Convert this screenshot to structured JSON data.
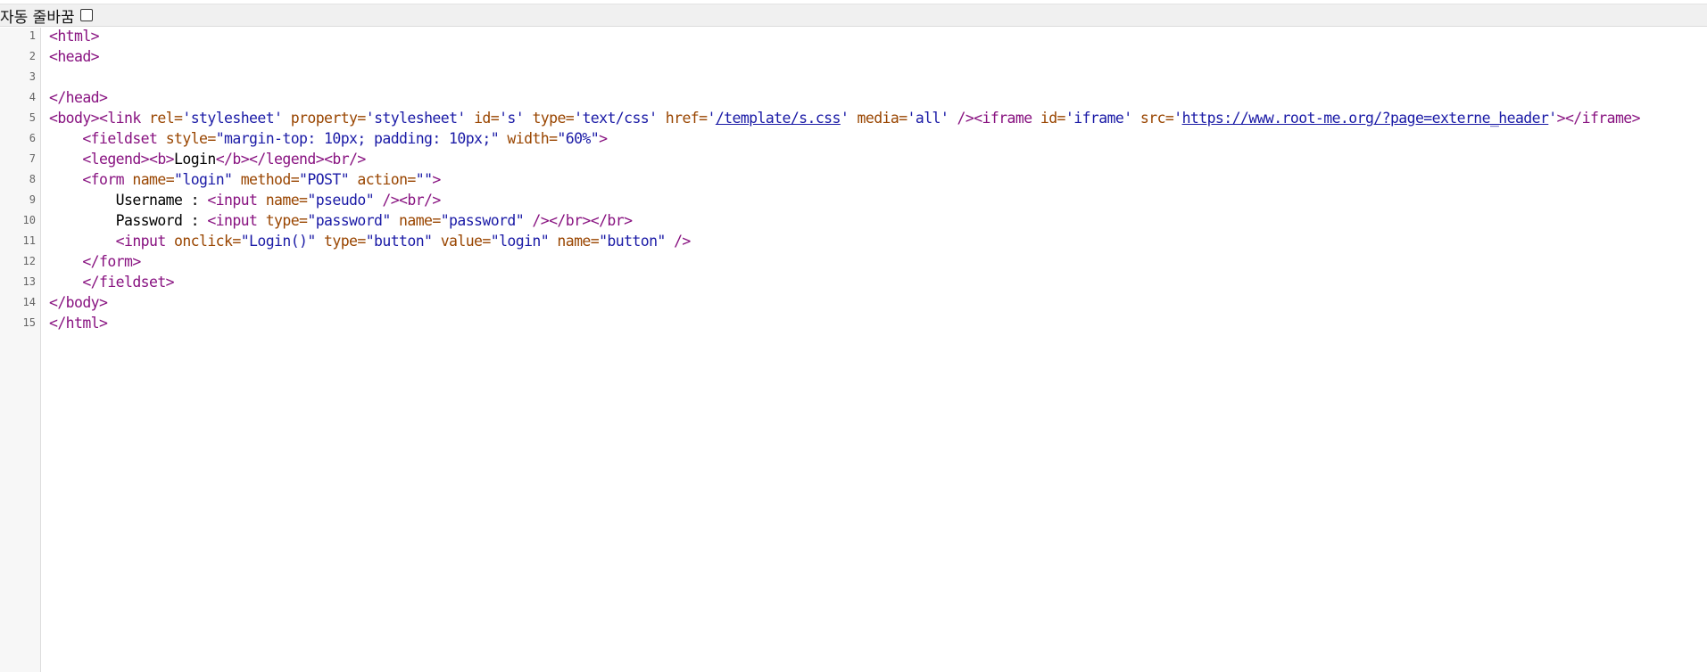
{
  "toolbar": {
    "wrap_label": "자동 줄바꿈",
    "wrap_checked": false
  },
  "lines": [
    {
      "num": "1",
      "tokens": [
        {
          "t": "tag",
          "v": "<html>"
        }
      ]
    },
    {
      "num": "2",
      "tokens": [
        {
          "t": "tag",
          "v": "<head>"
        }
      ]
    },
    {
      "num": "3",
      "tokens": []
    },
    {
      "num": "4",
      "tokens": [
        {
          "t": "tag",
          "v": "</head>"
        }
      ]
    },
    {
      "num": "5",
      "tokens": [
        {
          "t": "tag",
          "v": "<body>"
        },
        {
          "t": "tag",
          "v": "<link "
        },
        {
          "t": "attr",
          "v": "rel="
        },
        {
          "t": "val",
          "v": "'stylesheet'"
        },
        {
          "t": "attr",
          "v": " property="
        },
        {
          "t": "val",
          "v": "'stylesheet'"
        },
        {
          "t": "attr",
          "v": " id="
        },
        {
          "t": "val",
          "v": "'s'"
        },
        {
          "t": "attr",
          "v": " type="
        },
        {
          "t": "val",
          "v": "'text/css'"
        },
        {
          "t": "attr",
          "v": " href="
        },
        {
          "t": "val",
          "v": "'"
        },
        {
          "t": "link",
          "v": "/template/s.css"
        },
        {
          "t": "val",
          "v": "'"
        },
        {
          "t": "attr",
          "v": " media="
        },
        {
          "t": "val",
          "v": "'all'"
        },
        {
          "t": "tag",
          "v": " />"
        },
        {
          "t": "tag",
          "v": "<iframe "
        },
        {
          "t": "attr",
          "v": "id="
        },
        {
          "t": "val",
          "v": "'iframe'"
        },
        {
          "t": "attr",
          "v": " src="
        },
        {
          "t": "val",
          "v": "'"
        },
        {
          "t": "link",
          "v": "https://www.root-me.org/?page=externe_header"
        },
        {
          "t": "val",
          "v": "'"
        },
        {
          "t": "tag",
          "v": "></iframe>"
        }
      ]
    },
    {
      "num": "6",
      "tokens": [
        {
          "t": "txt",
          "v": "    "
        },
        {
          "t": "tag",
          "v": "<fieldset "
        },
        {
          "t": "attr",
          "v": "style="
        },
        {
          "t": "val",
          "v": "\"margin-top: 10px; padding: 10px;\""
        },
        {
          "t": "attr",
          "v": " width="
        },
        {
          "t": "val",
          "v": "\"60%\""
        },
        {
          "t": "tag",
          "v": ">"
        }
      ]
    },
    {
      "num": "7",
      "tokens": [
        {
          "t": "txt",
          "v": "    "
        },
        {
          "t": "tag",
          "v": "<legend>"
        },
        {
          "t": "tag",
          "v": "<b>"
        },
        {
          "t": "txt",
          "v": "Login"
        },
        {
          "t": "tag",
          "v": "</b>"
        },
        {
          "t": "tag",
          "v": "</legend>"
        },
        {
          "t": "tag",
          "v": "<br/>"
        }
      ]
    },
    {
      "num": "8",
      "tokens": [
        {
          "t": "txt",
          "v": "    "
        },
        {
          "t": "tag",
          "v": "<form "
        },
        {
          "t": "attr",
          "v": "name="
        },
        {
          "t": "val",
          "v": "\"login\""
        },
        {
          "t": "attr",
          "v": " method="
        },
        {
          "t": "val",
          "v": "\"POST\""
        },
        {
          "t": "attr",
          "v": " action="
        },
        {
          "t": "val",
          "v": "\"\""
        },
        {
          "t": "tag",
          "v": ">"
        }
      ]
    },
    {
      "num": "9",
      "tokens": [
        {
          "t": "txt",
          "v": "        Username : "
        },
        {
          "t": "tag",
          "v": "<input "
        },
        {
          "t": "attr",
          "v": "name="
        },
        {
          "t": "val",
          "v": "\"pseudo\""
        },
        {
          "t": "tag",
          "v": " />"
        },
        {
          "t": "tag",
          "v": "<br/>"
        }
      ]
    },
    {
      "num": "10",
      "tokens": [
        {
          "t": "txt",
          "v": "        Password : "
        },
        {
          "t": "tag",
          "v": "<input "
        },
        {
          "t": "attr",
          "v": "type="
        },
        {
          "t": "val",
          "v": "\"password\""
        },
        {
          "t": "attr",
          "v": " name="
        },
        {
          "t": "val",
          "v": "\"password\""
        },
        {
          "t": "tag",
          "v": " />"
        },
        {
          "t": "tag",
          "v": "</br>"
        },
        {
          "t": "tag",
          "v": "</br>"
        }
      ]
    },
    {
      "num": "11",
      "tokens": [
        {
          "t": "txt",
          "v": "        "
        },
        {
          "t": "tag",
          "v": "<input "
        },
        {
          "t": "attr",
          "v": "onclick="
        },
        {
          "t": "val",
          "v": "\"Login()\""
        },
        {
          "t": "attr",
          "v": " type="
        },
        {
          "t": "val",
          "v": "\"button\""
        },
        {
          "t": "attr",
          "v": " value="
        },
        {
          "t": "val",
          "v": "\"login\""
        },
        {
          "t": "attr",
          "v": " name="
        },
        {
          "t": "val",
          "v": "\"button\""
        },
        {
          "t": "tag",
          "v": " />"
        }
      ]
    },
    {
      "num": "12",
      "tokens": [
        {
          "t": "txt",
          "v": "    "
        },
        {
          "t": "tag",
          "v": "</form>"
        }
      ]
    },
    {
      "num": "13",
      "tokens": [
        {
          "t": "txt",
          "v": "    "
        },
        {
          "t": "tag",
          "v": "</fieldset>"
        }
      ]
    },
    {
      "num": "14",
      "tokens": [
        {
          "t": "tag",
          "v": "</body>"
        }
      ]
    },
    {
      "num": "15",
      "tokens": [
        {
          "t": "tag",
          "v": "</html>"
        }
      ]
    }
  ]
}
